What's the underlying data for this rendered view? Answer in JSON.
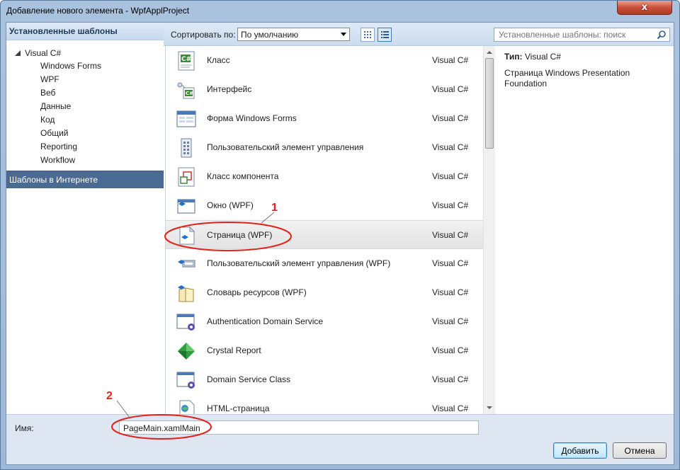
{
  "window": {
    "title": "Добавление нового элемента - WpfApplProject",
    "close_glyph": "x"
  },
  "left_panel": {
    "header": "Установленные шаблоны",
    "tree_root": "Visual C#",
    "tree_children": [
      "Windows Forms",
      "WPF",
      "Веб",
      "Данные",
      "Код",
      "Общий",
      "Reporting",
      "Workflow"
    ],
    "online_templates": "Шаблоны в Интернете"
  },
  "toolbar": {
    "sort_label": "Сортировать по:",
    "sort_value": "По умолчанию",
    "search_placeholder": "Установленные шаблоны: поиск"
  },
  "templates": [
    {
      "name": "Класс",
      "lang": "Visual C#",
      "icon": "class-icon"
    },
    {
      "name": "Интерфейс",
      "lang": "Visual C#",
      "icon": "interface-icon"
    },
    {
      "name": "Форма Windows Forms",
      "lang": "Visual C#",
      "icon": "windows-form-icon"
    },
    {
      "name": "Пользовательский элемент управления",
      "lang": "Visual C#",
      "icon": "user-control-icon"
    },
    {
      "name": "Класс компонента",
      "lang": "Visual C#",
      "icon": "component-class-icon"
    },
    {
      "name": "Окно (WPF)",
      "lang": "Visual C#",
      "icon": "wpf-window-icon"
    },
    {
      "name": "Страница (WPF)",
      "lang": "Visual C#",
      "icon": "wpf-page-icon"
    },
    {
      "name": "Пользовательский элемент управления (WPF)",
      "lang": "Visual C#",
      "icon": "wpf-user-control-icon"
    },
    {
      "name": "Словарь ресурсов (WPF)",
      "lang": "Visual C#",
      "icon": "resource-dictionary-icon"
    },
    {
      "name": "Authentication Domain Service",
      "lang": "Visual C#",
      "icon": "domain-service-icon"
    },
    {
      "name": "Crystal Report",
      "lang": "Visual C#",
      "icon": "crystal-report-icon"
    },
    {
      "name": "Domain Service Class",
      "lang": "Visual C#",
      "icon": "domain-service-icon"
    },
    {
      "name": "HTML-страница",
      "lang": "Visual C#",
      "icon": "html-page-icon"
    }
  ],
  "selected_template_index": 6,
  "description": {
    "type_label": "Тип:",
    "type_value": "Visual C#",
    "text": "Страница Windows Presentation Foundation"
  },
  "bottom": {
    "name_label": "Имя:",
    "name_value": "PageMain.xamlMain",
    "add_button": "Добавить",
    "cancel_button": "Отмена"
  },
  "annotations": {
    "marker_1": "1",
    "marker_2": "2",
    "color": "#e0221b"
  }
}
